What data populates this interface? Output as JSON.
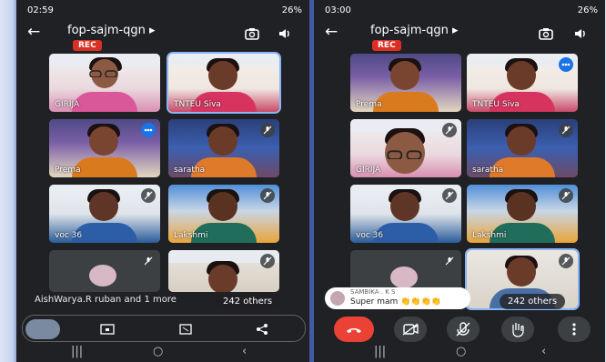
{
  "left_screen": {
    "status_bar": {
      "time": "02:59",
      "right": "26%"
    },
    "meeting_code": "fop-sajm-qgn",
    "rec_badge": "REC",
    "tiles": [
      {
        "name": "GIRIJA"
      },
      {
        "name": "TNTEU Siva"
      },
      {
        "name": "Prema"
      },
      {
        "name": "saratha"
      },
      {
        "name": "voc 36"
      },
      {
        "name": "Lakshmi"
      },
      {
        "name": ""
      },
      {
        "name": ""
      }
    ],
    "participants_caption": "AishWarya.R ruban and 1 more",
    "others_label": "242 others"
  },
  "right_screen": {
    "status_bar": {
      "time": "03:00",
      "right": "26%"
    },
    "meeting_code": "fop-sajm-qgn",
    "rec_badge": "REC",
    "tiles": [
      {
        "name": "Prema"
      },
      {
        "name": "TNTEU Siva"
      },
      {
        "name": "GIRIJA"
      },
      {
        "name": "saratha"
      },
      {
        "name": "voc 36"
      },
      {
        "name": "Lakshmi"
      },
      {
        "name": ""
      },
      {
        "name": ""
      }
    ],
    "chat_toast": {
      "sender": "SAMBIKA . K S",
      "message": "Super mam 👏👏👏👏"
    },
    "others_label": "242 others"
  },
  "colors": {
    "rec": "#d93025",
    "end_call": "#ea4335",
    "highlight": "#8ab4f8",
    "dark_bg": "#202124"
  },
  "icons": [
    "back-arrow-icon",
    "camera-switch-icon",
    "speaker-icon",
    "mic-off-icon",
    "audio-level-icon",
    "end-call-icon",
    "camera-off-icon",
    "raise-hand-icon",
    "more-options-icon",
    "share-icon",
    "screen-icon",
    "effects-icon"
  ]
}
